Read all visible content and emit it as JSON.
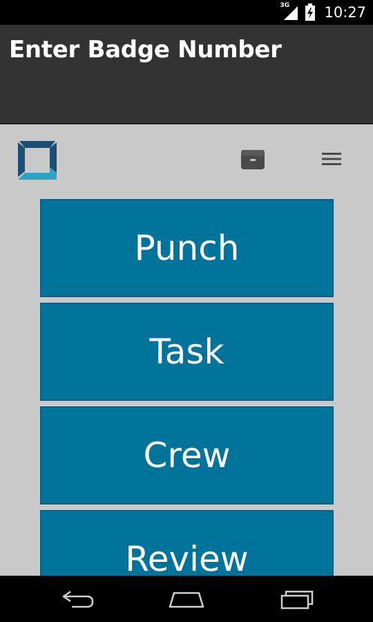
{
  "status_bar": {
    "network": "3G",
    "time": "10:27",
    "icons": [
      "signal-icon",
      "battery-icon"
    ]
  },
  "header": {
    "title": "Enter Badge Number"
  },
  "toolbar": {
    "logo": "app-logo",
    "icons": [
      "archive-icon",
      "menu-icon"
    ]
  },
  "menu": {
    "items": [
      {
        "label": "Punch"
      },
      {
        "label": "Task"
      },
      {
        "label": "Crew"
      },
      {
        "label": "Review"
      }
    ]
  },
  "nav_bar": {
    "icons": [
      "back-icon",
      "home-icon",
      "recent-apps-icon"
    ]
  },
  "colors": {
    "tile": "#00739b",
    "header": "#323232",
    "background": "#c9c9c9",
    "logo_dark": "#1b4f72",
    "logo_light": "#2aa3c4"
  }
}
